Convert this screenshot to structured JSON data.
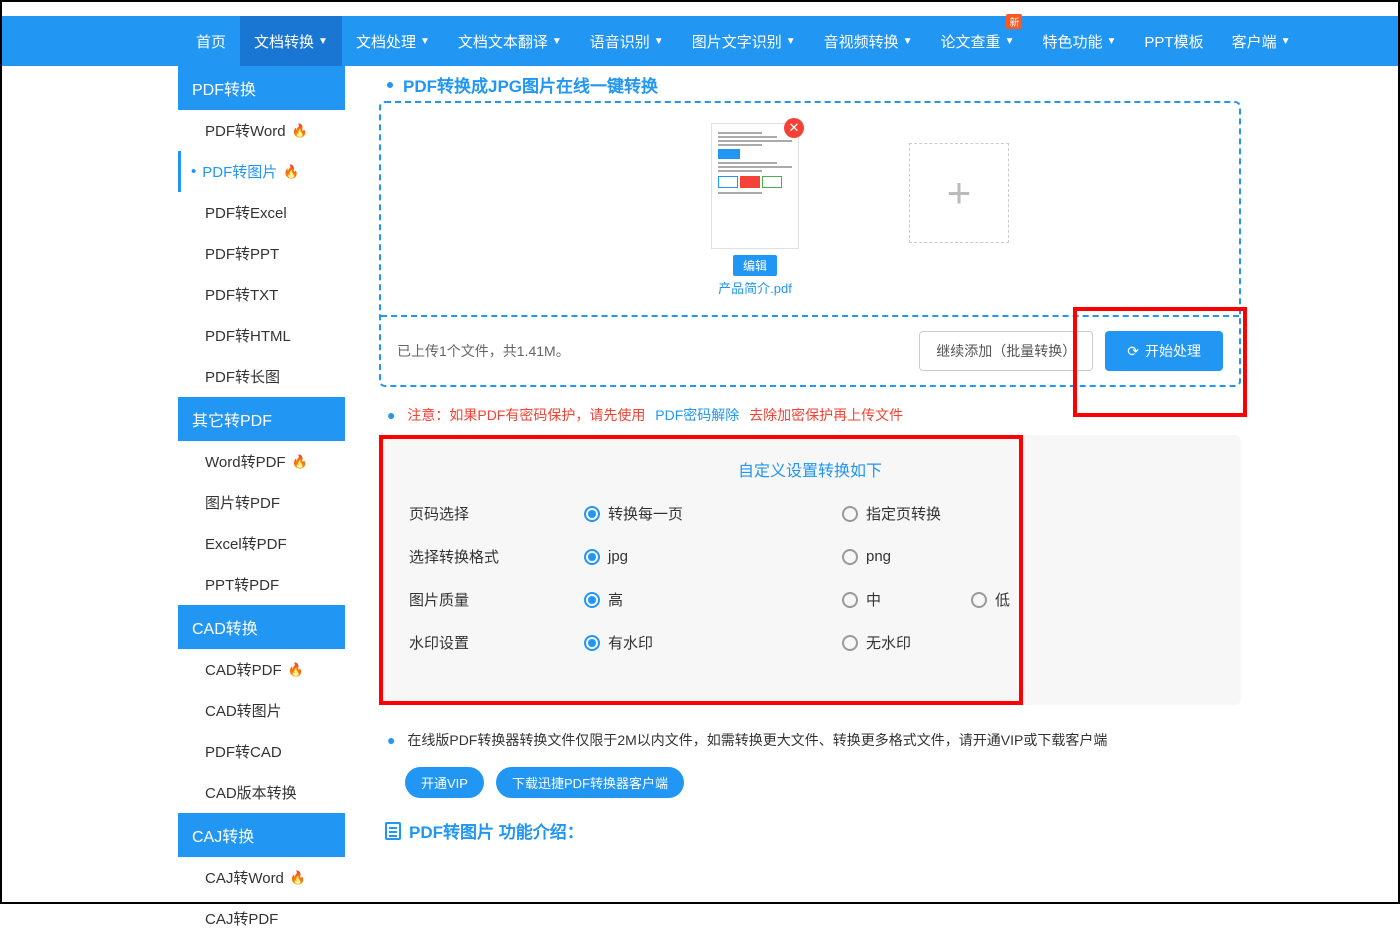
{
  "topnav": [
    {
      "label": "首页",
      "dropdown": false
    },
    {
      "label": "文档转换",
      "dropdown": true,
      "active": true
    },
    {
      "label": "文档处理",
      "dropdown": true
    },
    {
      "label": "文档文本翻译",
      "dropdown": true
    },
    {
      "label": "语音识别",
      "dropdown": true
    },
    {
      "label": "图片文字识别",
      "dropdown": true
    },
    {
      "label": "音视频转换",
      "dropdown": true
    },
    {
      "label": "论文查重",
      "dropdown": true,
      "badge": "新"
    },
    {
      "label": "特色功能",
      "dropdown": true
    },
    {
      "label": "PPT模板"
    },
    {
      "label": "客户端",
      "dropdown": true
    }
  ],
  "sidebar": {
    "groups": [
      {
        "header": "PDF转换",
        "items": [
          {
            "label": "PDF转Word",
            "hot": true
          },
          {
            "label": "PDF转图片",
            "hot": true,
            "active": true
          },
          {
            "label": "PDF转Excel"
          },
          {
            "label": "PDF转PPT"
          },
          {
            "label": "PDF转TXT"
          },
          {
            "label": "PDF转HTML"
          },
          {
            "label": "PDF转长图"
          }
        ]
      },
      {
        "header": "其它转PDF",
        "items": [
          {
            "label": "Word转PDF",
            "hot": true
          },
          {
            "label": "图片转PDF"
          },
          {
            "label": "Excel转PDF"
          },
          {
            "label": "PPT转PDF"
          }
        ]
      },
      {
        "header": "CAD转换",
        "items": [
          {
            "label": "CAD转PDF",
            "hot": true
          },
          {
            "label": "CAD转图片"
          },
          {
            "label": "PDF转CAD"
          },
          {
            "label": "CAD版本转换"
          }
        ]
      },
      {
        "header": "CAJ转换",
        "items": [
          {
            "label": "CAJ转Word",
            "hot": true
          },
          {
            "label": "CAJ转PDF"
          }
        ]
      }
    ]
  },
  "page_title": "PDF转换成JPG图片在线一键转换",
  "file": {
    "edit": "编辑",
    "name": "产品简介.pdf"
  },
  "status": "已上传1个文件，共1.41M。",
  "continue_add": "继续添加（批量转换）",
  "start": "开始处理",
  "notice": {
    "pre": "注意：如果PDF有密码保护，请先使用",
    "link": "PDF密码解除",
    "post": "去除加密保护再上传文件"
  },
  "settings": {
    "title": "自定义设置转换如下",
    "rows": [
      {
        "label": "页码选择",
        "options": [
          {
            "t": "转换每一页",
            "c": true
          },
          {
            "t": "指定页转换"
          }
        ]
      },
      {
        "label": "选择转换格式",
        "options": [
          {
            "t": "jpg",
            "c": true
          },
          {
            "t": "png"
          }
        ]
      },
      {
        "label": "图片质量",
        "options": [
          {
            "t": "高",
            "c": true
          },
          {
            "t": "中"
          },
          {
            "t": "低"
          }
        ]
      },
      {
        "label": "水印设置",
        "options": [
          {
            "t": "有水印",
            "c": true
          },
          {
            "t": "无水印"
          }
        ]
      }
    ]
  },
  "info_text": "在线版PDF转换器转换文件仅限于2M以内文件，如需转换更大文件、转换更多格式文件，请开通VIP或下载客户端",
  "pill1": "开通VIP",
  "pill2": "下载迅捷PDF转换器客户端",
  "feature_title": "PDF转图片 功能介绍："
}
